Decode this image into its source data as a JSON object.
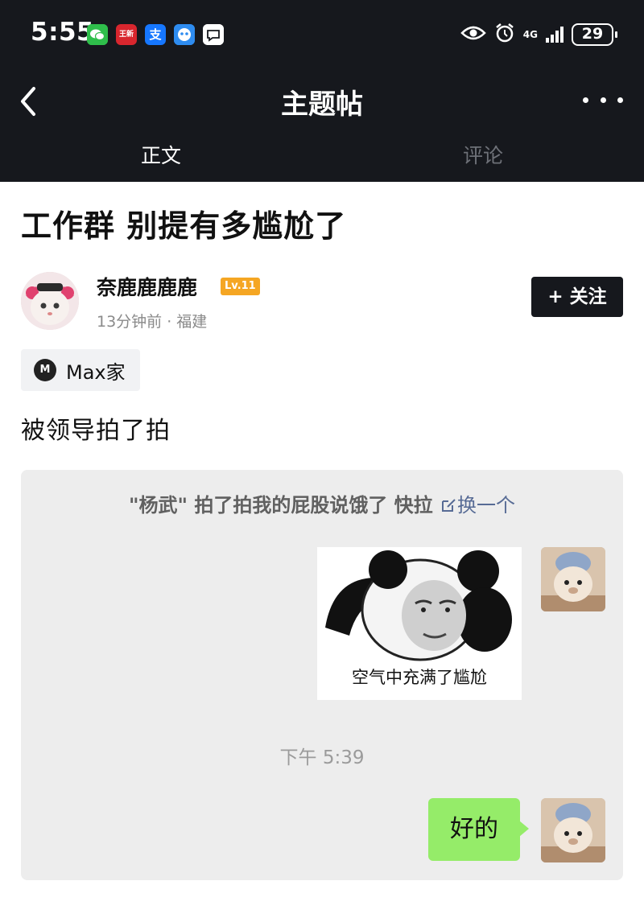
{
  "status_bar": {
    "time": "5:55",
    "network": "4G",
    "battery": "29",
    "app_icons": [
      "wechat-icon",
      "news-app-icon",
      "alipay-icon",
      "robot-app-icon",
      "chat-app-icon"
    ],
    "news_icon_text": "王新",
    "alipay_icon_text": "支"
  },
  "nav": {
    "title": "主题帖",
    "tabs": [
      {
        "label": "正文",
        "active": true
      },
      {
        "label": "评论",
        "active": false
      }
    ]
  },
  "post": {
    "title": "工作群 别提有多尴尬了",
    "author": "奈鹿鹿鹿鹿",
    "level": "Lv.11",
    "meta": "13分钟前 · 福建",
    "follow_label": "+ 关注",
    "community": {
      "logo": "M",
      "name": "Max家"
    },
    "body": "被领导拍了拍"
  },
  "chat_screenshot": {
    "system_message": "\"杨武\" 拍了拍我的屁股说饿了 快拉",
    "system_link": "换一个",
    "sticker_caption": "空气中充满了尴尬",
    "timestamp": "下午 5:39",
    "reply": "好的"
  },
  "colors": {
    "header_bg": "#16181d",
    "level_badge": "#f5a623",
    "bubble_green": "#95ec69",
    "link_blue": "#576b95",
    "chat_bg": "#ededed"
  }
}
